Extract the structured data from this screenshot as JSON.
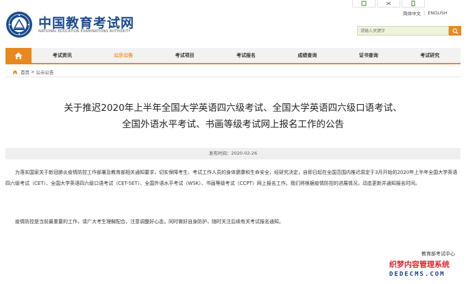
{
  "header": {
    "site_title": "中国教育考试网",
    "site_subtitle": "NATIONAL EDUCATION EXAMINATIONS AUTHORITY",
    "lang_cn": "简体中文",
    "lang_en": "ENGLISH",
    "search_placeholder": "请输入关键字"
  },
  "nav": {
    "items": [
      {
        "label": "考试资讯"
      },
      {
        "label": "公示公告"
      },
      {
        "label": "考试项目"
      },
      {
        "label": "考试报名"
      },
      {
        "label": "成绩查询"
      },
      {
        "label": "证书查询"
      },
      {
        "label": "考试研究"
      }
    ]
  },
  "breadcrumb": {
    "home": "首页",
    "sep": ">",
    "current": "公示公告"
  },
  "article": {
    "title_line1": "关于推迟2020年上半年全国大学英语四六级考试、全国大学英语四六级口语考试、",
    "title_line2": "全国外语水平考试、书画等级考试网上报名工作的公告",
    "date": "发布时间：2020-02-26",
    "para1": "为落实国家关于新冠肺炎疫情防控工作部署及教育部相关通知要求，切实保障考生、考试工作人员的身体健康和生命安全，经研究决定，自即日起在全国范围内推迟原定于3月开始的2020年上半年全国大学英语四六级考试（CET）、全国大学英语四六级口语考试（CET-SET）、全国外语水平考试（WSK）、书画等级考试（CCPT）网上报名工作。我们将根据疫情防控的进展情况，动态更新并通知报名时间。",
    "para2": "疫情防控是当前最重要的工作，请广大考生理解配合，注意调整好心态，同时做好自身防护，随时关注后续有关考试报名通知。",
    "signature": "教育部考试中心"
  },
  "watermark": {
    "cn": "织梦内容管理系统",
    "en": "DEDECMS.COM"
  }
}
